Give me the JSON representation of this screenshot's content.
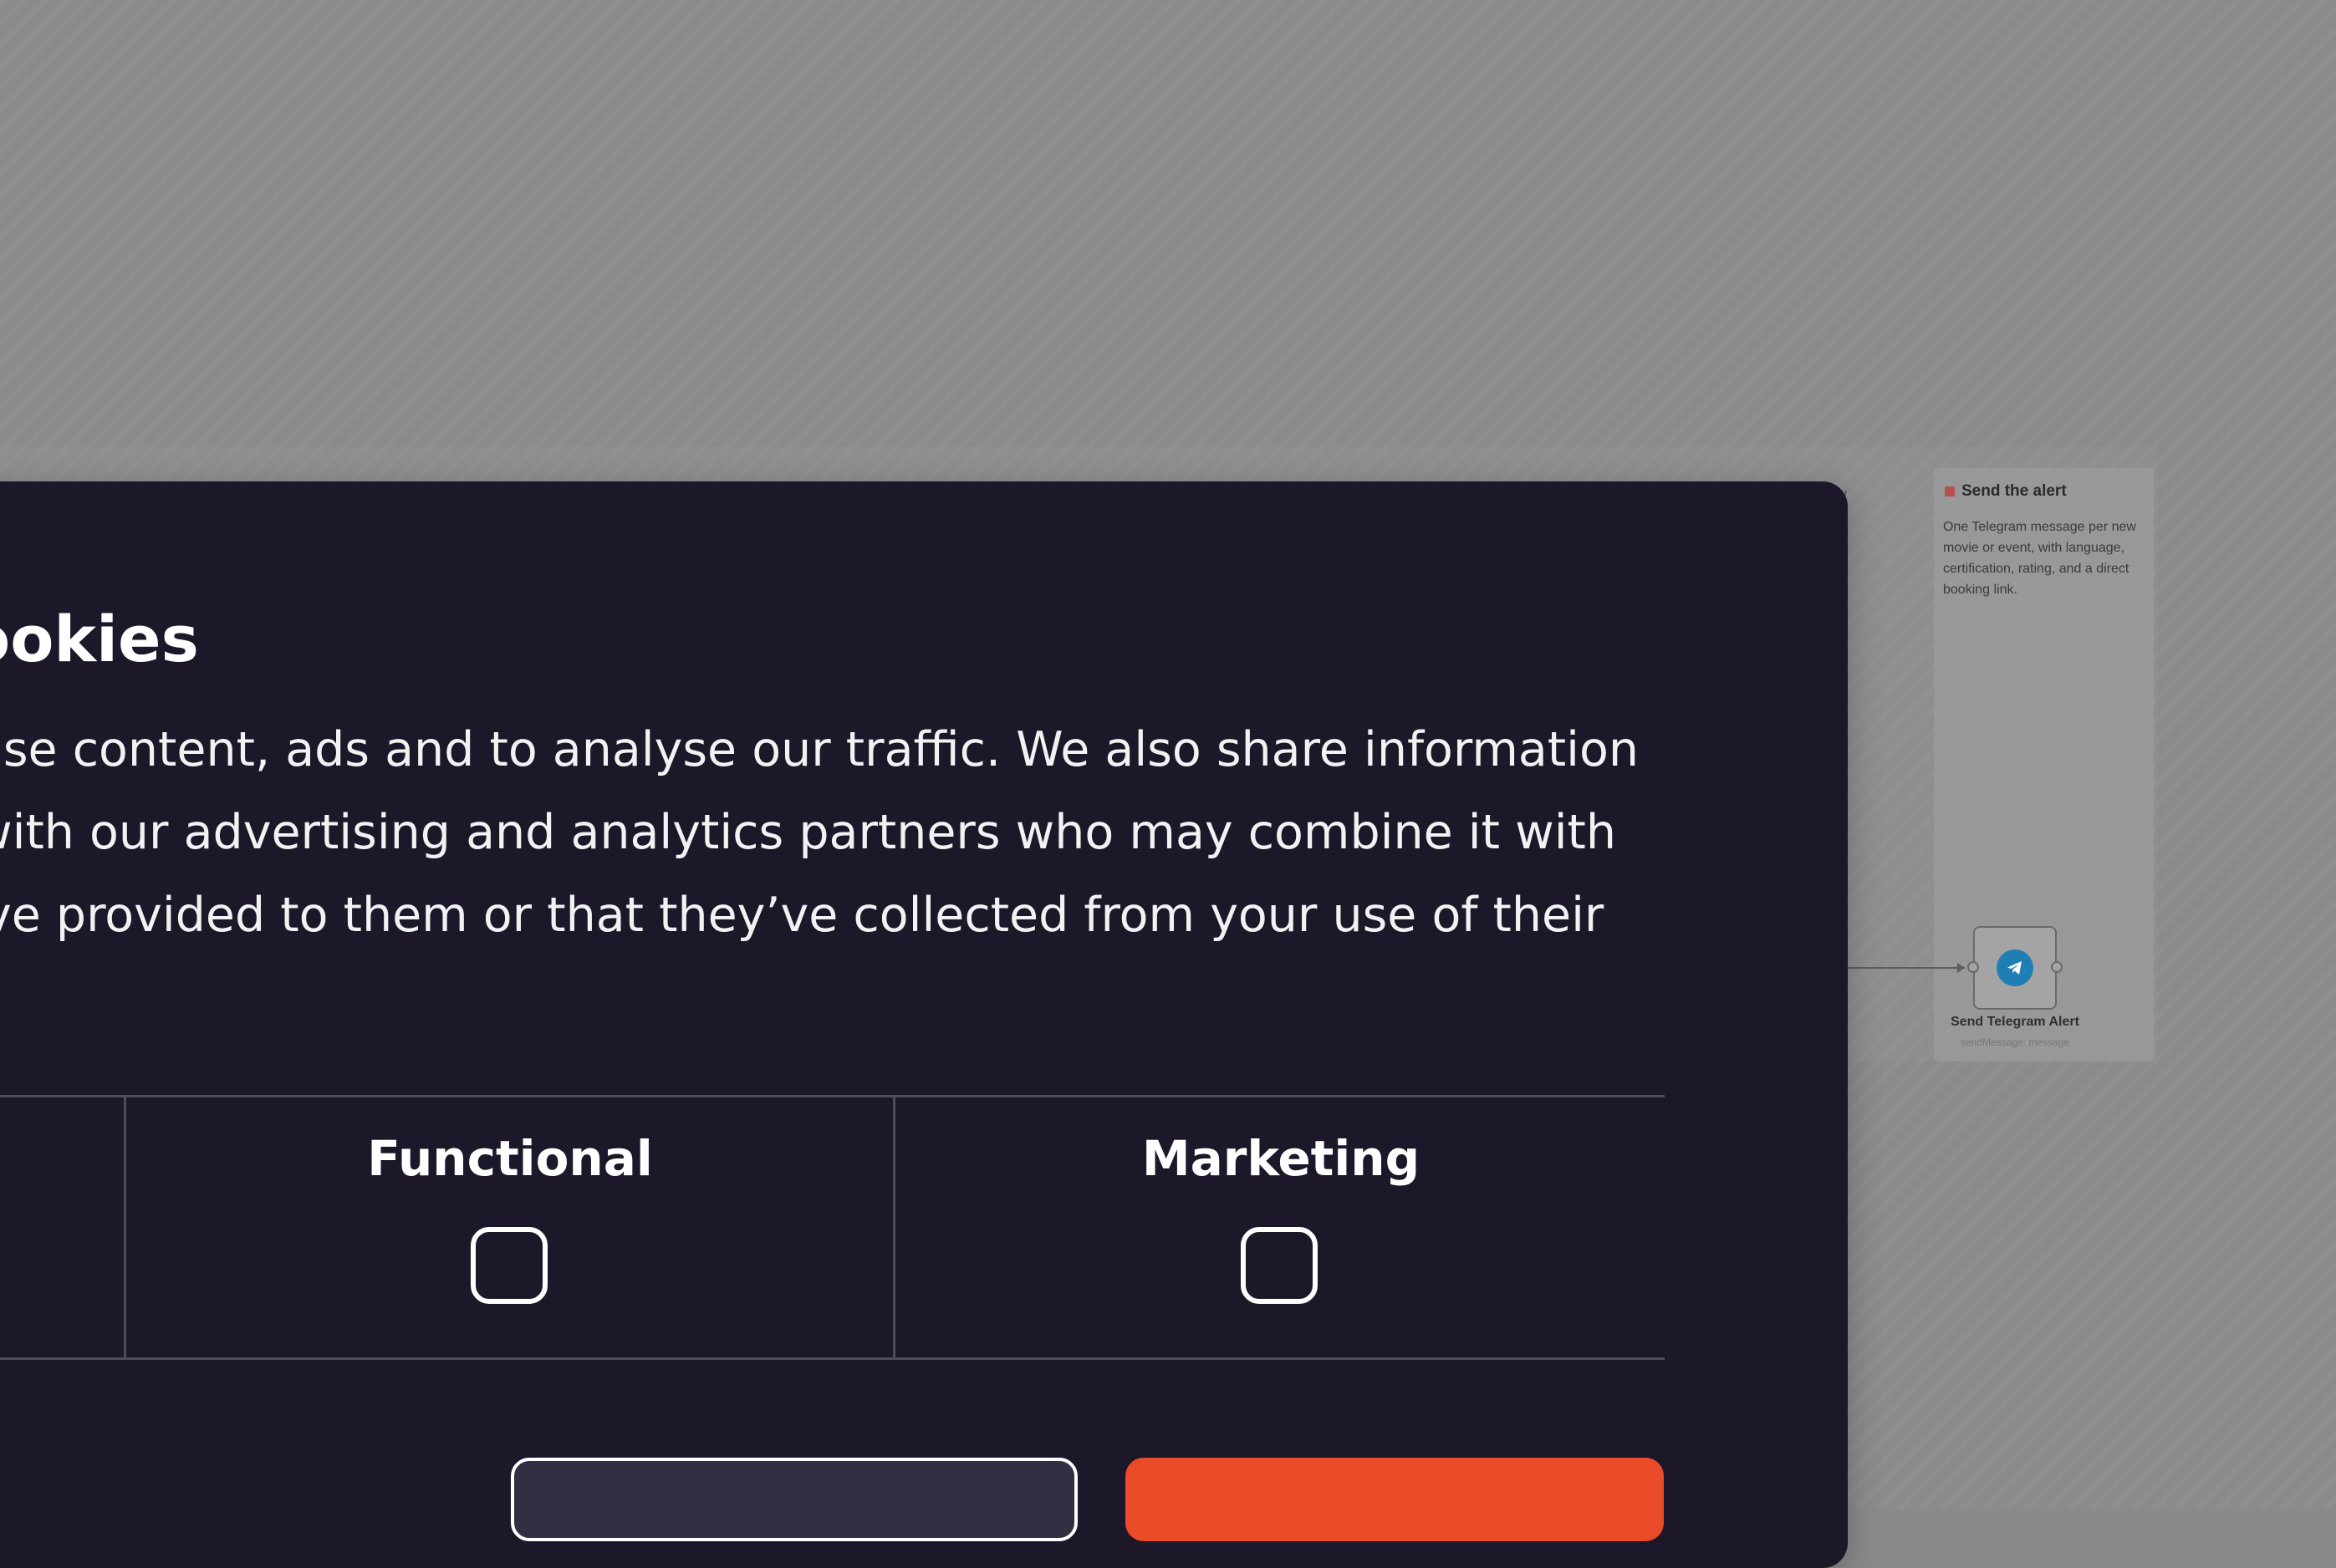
{
  "background": {
    "sticky_note": {
      "title": "Send the alert",
      "body": "One Telegram message per new movie or event, with language, certification, rating, and a direct booking link."
    },
    "hidden_fragments": [
      "w",
      "ts"
    ],
    "node": {
      "label": "Send Telegram Alert",
      "sublabel": "sendMessage: message",
      "icon": "telegram-icon",
      "icon_color": "#1f7fb4"
    }
  },
  "cookie_modal": {
    "title": "ookies",
    "text_lines": [
      "ise content, ads and to analyse our traffic. We also share information",
      "with our advertising and analytics partners who may combine it with",
      "ve provided to them or that they’ve collected from your use of their"
    ],
    "preferences": [
      {
        "label": "Functional",
        "checked": false
      },
      {
        "label": "Marketing",
        "checked": false
      }
    ],
    "colors": {
      "modal_bg": "#1c1829",
      "primary_button": "#ea4b29",
      "secondary_button": "#332e42"
    }
  }
}
